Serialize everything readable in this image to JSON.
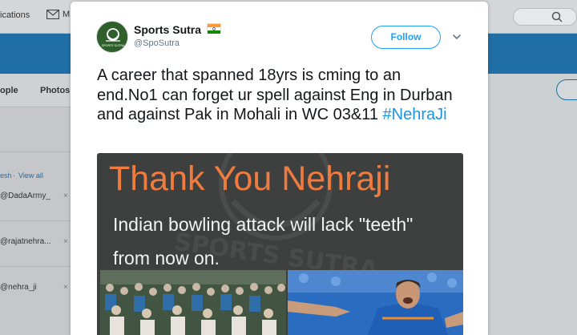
{
  "background": {
    "nav": {
      "notifications_label": "ications",
      "messages_label": "M"
    },
    "profile_tabs": {
      "people": "ople",
      "photos": "Photos"
    },
    "sidebar": {
      "refresh_link": "esh",
      "separator": "·",
      "view_all_link": "View all",
      "users": [
        "@DadaArmy_",
        "@rajatnehra...",
        "@nehra_ji"
      ],
      "dismiss_glyph": "×"
    }
  },
  "tweet": {
    "author": {
      "display_name": "Sports Sutra",
      "handle": "@SpoSutra",
      "avatar_text": "SPORTS SUTRA"
    },
    "follow_label": "Follow",
    "text_main": "A career that spanned 18yrs is cming to an end.No1 can forget ur spell against Eng in Durban and against Pak in Mohali in WC 03&11",
    "hashtag": "#NehraJi",
    "media": {
      "title": "Thank You Nehraji",
      "subtitle_line1": "Indian bowling attack will lack \"teeth\"",
      "subtitle_line2": "from now on.",
      "watermark_text": "SPORTS SUTRA"
    }
  },
  "colors": {
    "accent": "#1da1f2",
    "hashtag": "#1b95e0",
    "media_title": "#f07b3f",
    "media_bg": "#3e403f",
    "banner": "#1f6ea6"
  },
  "icons": [
    "mail-icon",
    "chevron-down-icon",
    "flag-india-icon"
  ]
}
